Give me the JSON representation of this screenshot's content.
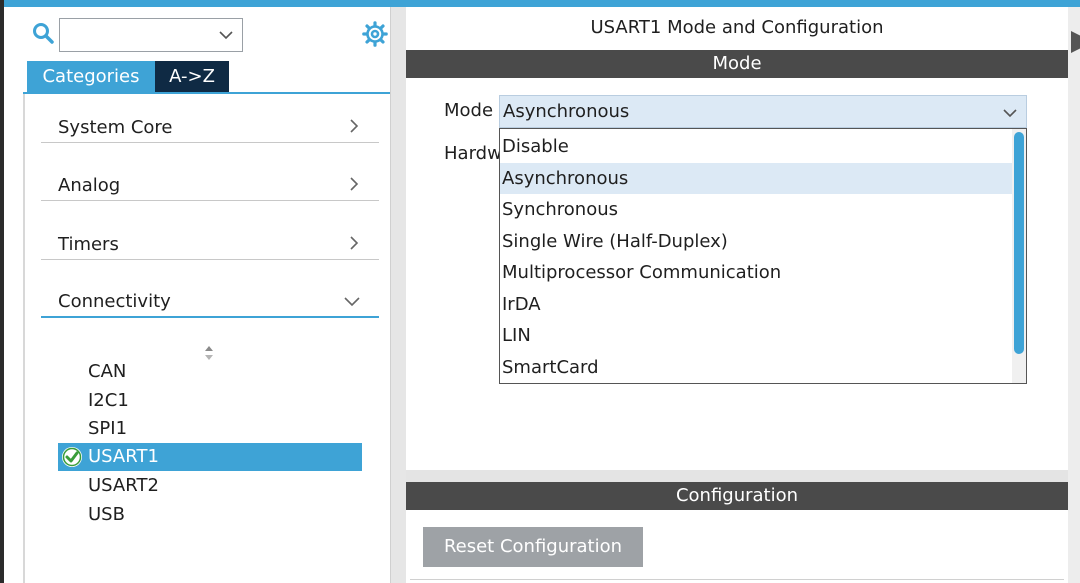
{
  "colors": {
    "accent": "#3ea3d6",
    "tab_dark": "#0f2a44",
    "section_bar": "#4a4a4a",
    "selection_bg": "#dce9f5",
    "button_gray": "#9ea2a6",
    "check_green": "#3a9d3a"
  },
  "left": {
    "search": {
      "value": "",
      "icon": "search-icon",
      "dropdown_icon": "chevron-down-icon"
    },
    "settings_icon": "gear-icon",
    "tabs": [
      {
        "label": "Categories",
        "active": true
      },
      {
        "label": "A->Z",
        "active": false
      }
    ],
    "categories": [
      {
        "label": "System Core",
        "expanded": false
      },
      {
        "label": "Analog",
        "expanded": false
      },
      {
        "label": "Timers",
        "expanded": false
      },
      {
        "label": "Connectivity",
        "expanded": true
      }
    ],
    "peripherals": [
      {
        "label": "CAN",
        "selected": false,
        "enabled": false
      },
      {
        "label": "I2C1",
        "selected": false,
        "enabled": false
      },
      {
        "label": "SPI1",
        "selected": false,
        "enabled": false
      },
      {
        "label": "USART1",
        "selected": true,
        "enabled": true
      },
      {
        "label": "USART2",
        "selected": false,
        "enabled": false
      },
      {
        "label": "USB",
        "selected": false,
        "enabled": false
      }
    ]
  },
  "right": {
    "title": "USART1 Mode and Configuration",
    "mode_section": "Mode",
    "mode_label": "Mode",
    "mode_value": "Asynchronous",
    "hardware_label": "Hardw",
    "mode_options": [
      {
        "label": "Disable",
        "selected": false
      },
      {
        "label": "Asynchronous",
        "selected": true
      },
      {
        "label": "Synchronous",
        "selected": false
      },
      {
        "label": "Single Wire (Half-Duplex)",
        "selected": false
      },
      {
        "label": "Multiprocessor Communication",
        "selected": false
      },
      {
        "label": "IrDA",
        "selected": false
      },
      {
        "label": "LIN",
        "selected": false
      },
      {
        "label": "SmartCard",
        "selected": false
      }
    ],
    "config_section": "Configuration",
    "reset_button": "Reset Configuration"
  }
}
